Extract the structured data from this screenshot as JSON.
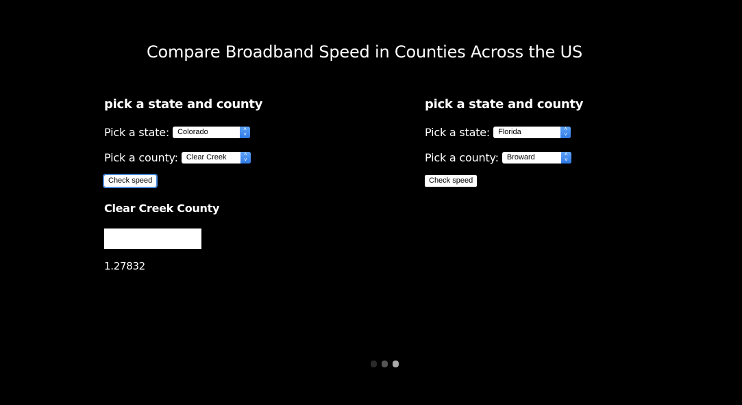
{
  "title": "Compare Broadband Speed in Counties Across the US",
  "panels": [
    {
      "heading": "pick a state and county",
      "state_label": "Pick a state:",
      "state_value": "Colorado",
      "county_label": "Pick a county:",
      "county_value": "Clear Creek",
      "button_label": "Check speed",
      "result": {
        "county_name": "Clear Creek County",
        "value": "1.27832"
      }
    },
    {
      "heading": "pick a state and county",
      "state_label": "Pick a state:",
      "state_value": "Florida",
      "county_label": "Pick a county:",
      "county_value": "Broward",
      "button_label": "Check speed"
    }
  ],
  "pager": {
    "count": 3,
    "active_index": 2
  },
  "colors": {
    "background": "#000000",
    "text": "#ffffff",
    "select_accent": "#3b86ef"
  }
}
